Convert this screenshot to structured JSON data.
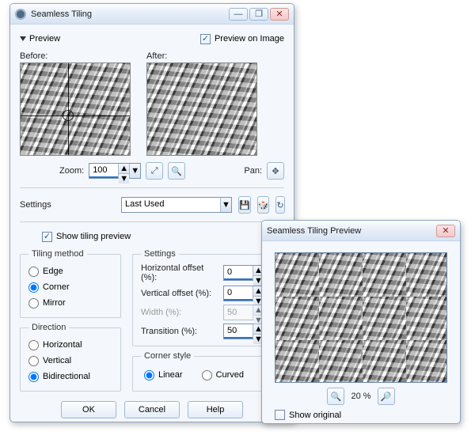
{
  "mainWindow": {
    "title": "Seamless Tiling",
    "previewHeader": "Preview",
    "previewOnImage": "Preview on Image",
    "beforeLabel": "Before:",
    "afterLabel": "After:",
    "zoomLabel": "Zoom:",
    "zoomValue": "100",
    "panLabel": "Pan:",
    "settingsLabel": "Settings",
    "settingsPreset": "Last Used",
    "showTilingPreview": "Show tiling preview",
    "tilingMethod": {
      "legend": "Tiling method",
      "edge": "Edge",
      "corner": "Corner",
      "mirror": "Mirror",
      "selected": "corner"
    },
    "direction": {
      "legend": "Direction",
      "horizontal": "Horizontal",
      "vertical": "Vertical",
      "bidirectional": "Bidirectional",
      "selected": "bidirectional"
    },
    "settingsGroup": {
      "legend": "Settings",
      "hoff": "Horizontal offset (%):",
      "hoffVal": "0",
      "voff": "Vertical offset (%):",
      "voffVal": "0",
      "width": "Width (%):",
      "widthVal": "50",
      "trans": "Transition (%):",
      "transVal": "50"
    },
    "cornerStyle": {
      "legend": "Corner style",
      "linear": "Linear",
      "curved": "Curved",
      "selected": "linear"
    },
    "buttons": {
      "ok": "OK",
      "cancel": "Cancel",
      "help": "Help"
    }
  },
  "previewWindow": {
    "title": "Seamless Tiling Preview",
    "zoomText": "20 %",
    "showOriginal": "Show original"
  },
  "glyphs": {
    "min": "—",
    "max": "❐",
    "close": "✕",
    "closeX": "✕",
    "up": "▲",
    "down": "▼",
    "dd": "▼",
    "fit": "⤢",
    "onehundred": "🔍",
    "pan": "✥",
    "save": "💾",
    "rand": "🎲",
    "reset": "↻",
    "zoomOut": "🔍",
    "zoomIn": "🔎",
    "check": "✓"
  }
}
